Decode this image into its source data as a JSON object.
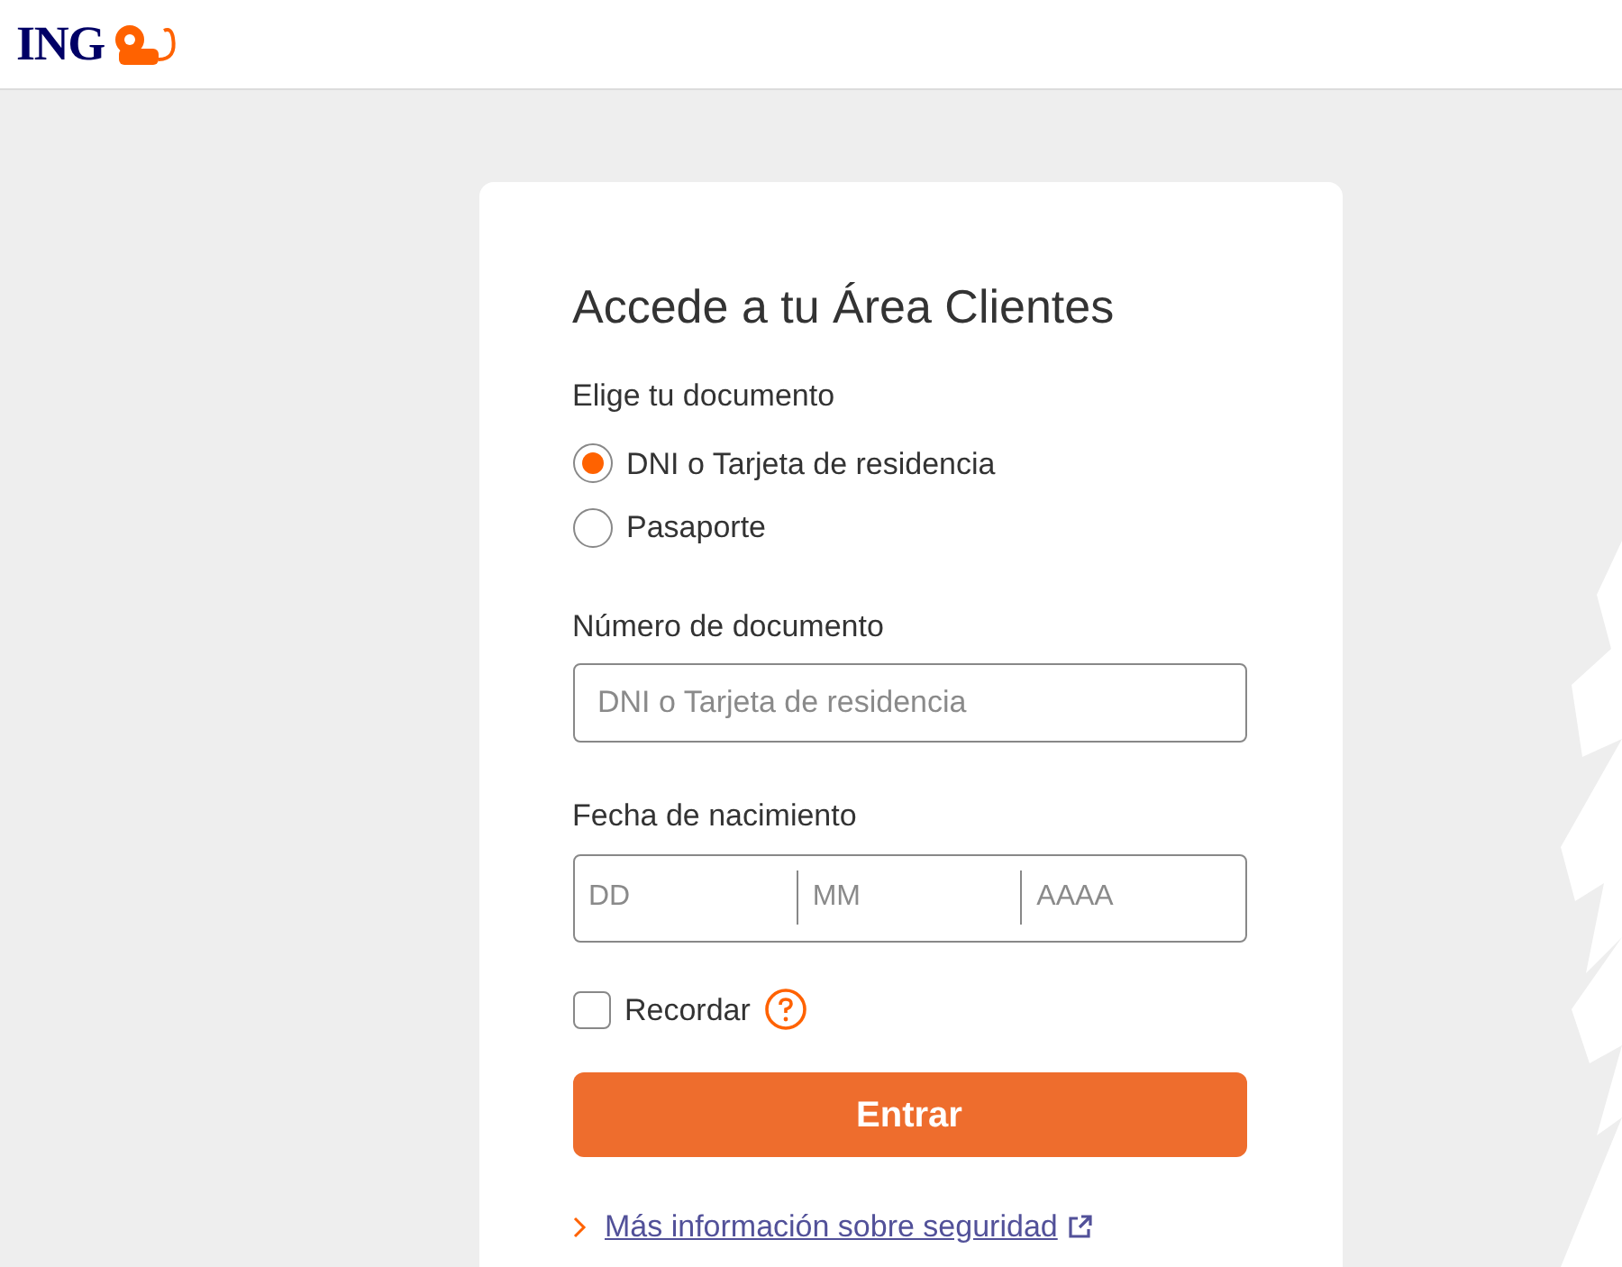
{
  "header": {
    "logo_text": "ING"
  },
  "login": {
    "title": "Accede a tu Área Clientes",
    "document_label": "Elige tu documento",
    "document_options": [
      {
        "label": "DNI o Tarjeta de residencia",
        "selected": true
      },
      {
        "label": "Pasaporte",
        "selected": false
      }
    ],
    "number_label": "Número de documento",
    "number_placeholder": "DNI o Tarjeta de residencia",
    "birth_label": "Fecha de nacimiento",
    "birth_fields": [
      {
        "placeholder": "DD"
      },
      {
        "placeholder": "MM"
      },
      {
        "placeholder": "AAAA"
      }
    ],
    "remember": {
      "label": "Recordar",
      "checked": false
    },
    "submit": "Entrar",
    "security_link": "Más información sobre seguridad"
  }
}
